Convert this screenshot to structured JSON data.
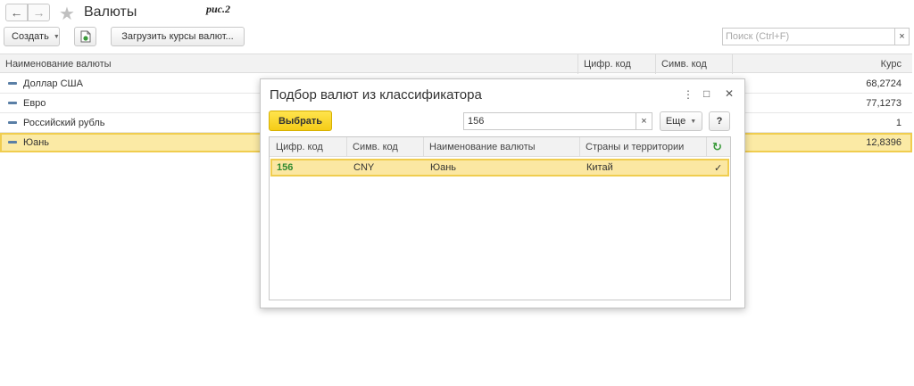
{
  "header": {
    "back_icon": "←",
    "forward_icon": "→",
    "favorite_icon": "★",
    "title": "Валюты",
    "note": "рис.2"
  },
  "toolbar": {
    "create_label": "Создать",
    "load_rates_label": "Загрузить курсы валют...",
    "search_placeholder": "Поиск (Ctrl+F)",
    "search_clear": "×"
  },
  "main_table": {
    "columns": [
      "Наименование валюты",
      "Цифр. код",
      "Симв. код",
      "Курс"
    ],
    "rows": [
      {
        "name": "Доллар США",
        "rate": "68,2724"
      },
      {
        "name": "Евро",
        "rate": "77,1273"
      },
      {
        "name": "Российский рубль",
        "rate": "1"
      },
      {
        "name": "Юань",
        "rate": "12,8396",
        "selected": true
      }
    ]
  },
  "dialog": {
    "title": "Подбор валют из классификатора",
    "menu_icon": "⋮",
    "maximize_icon": "□",
    "close_icon": "✕",
    "select_label": "Выбрать",
    "search_value": "156",
    "search_clear": "×",
    "more_label": "Еще",
    "help_label": "?",
    "columns": [
      "Цифр. код",
      "Симв. код",
      "Наименование валюты",
      "Страны и территории"
    ],
    "refresh_icon": "↻",
    "rows": [
      {
        "code": "156",
        "symbol": "CNY",
        "name": "Юань",
        "countries": "Китай",
        "check": "✓"
      }
    ]
  }
}
